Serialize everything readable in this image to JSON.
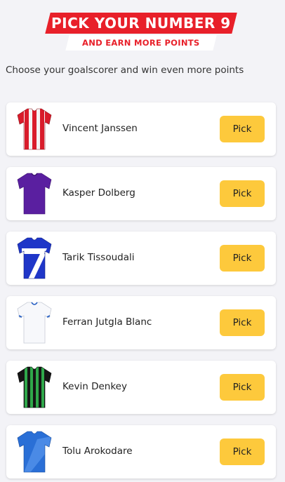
{
  "header": {
    "title": "PICK YOUR NUMBER 9",
    "subtitle": "AND EARN MORE POINTS",
    "accent_color": "#e8202a"
  },
  "intro": "Choose your goalscorer and win even more points",
  "pick_button_color": "#fdc93c",
  "players": [
    {
      "name": "Vincent Janssen",
      "pick_label": "Pick",
      "shirt_icon": "red-white-striped-shirt-icon"
    },
    {
      "name": "Kasper Dolberg",
      "pick_label": "Pick",
      "shirt_icon": "purple-shirt-icon"
    },
    {
      "name": "Tarik Tissoudali",
      "pick_label": "Pick",
      "shirt_icon": "blue-white-shirt-icon"
    },
    {
      "name": "Ferran Jutgla Blanc",
      "pick_label": "Pick",
      "shirt_icon": "white-shirt-icon"
    },
    {
      "name": "Kevin Denkey",
      "pick_label": "Pick",
      "shirt_icon": "green-black-striped-shirt-icon"
    },
    {
      "name": "Tolu Arokodare",
      "pick_label": "Pick",
      "shirt_icon": "blue-shirt-icon"
    }
  ]
}
